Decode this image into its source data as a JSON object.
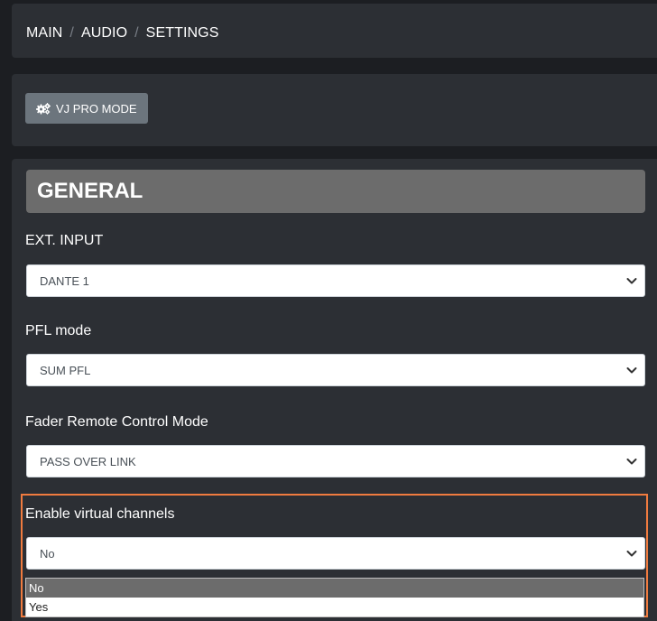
{
  "breadcrumb": {
    "items": [
      "MAIN",
      "AUDIO",
      "SETTINGS"
    ],
    "separator": "/"
  },
  "mode_button": {
    "label": "VJ PRO MODE",
    "icon": "cogs-icon"
  },
  "section": {
    "title": "GENERAL"
  },
  "fields": {
    "ext_input": {
      "label": "EXT. INPUT",
      "value": "DANTE 1"
    },
    "pfl_mode": {
      "label": "PFL mode",
      "value": "SUM PFL"
    },
    "fader_remote": {
      "label": "Fader Remote Control Mode",
      "value": "PASS OVER LINK"
    },
    "virtual_channels": {
      "label": "Enable virtual channels",
      "value": "No",
      "options": [
        "No",
        "Yes"
      ],
      "selected_index": 0
    }
  },
  "colors": {
    "background": "#1c1e22",
    "card": "#2c2f34",
    "section_header": "#6c6c6c",
    "button": "#6c757d",
    "highlight": "#f07b3f"
  }
}
